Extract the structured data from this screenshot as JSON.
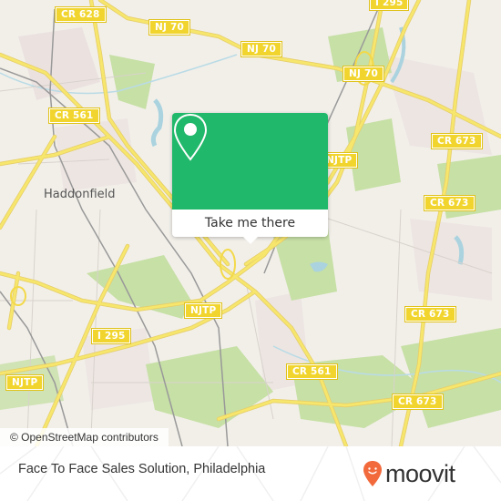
{
  "map": {
    "place_labels": [
      "Haddonfield"
    ],
    "road_shields": [
      "CR 628",
      "NJ 70",
      "NJ 70",
      "NJ 70",
      "I 295",
      "CR 561",
      "NJTP",
      "CR 673",
      "CR 673",
      "I 295",
      "NJTP",
      "NJTP",
      "CR 673",
      "CR 561",
      "CR 673"
    ],
    "attribution": "© OpenStreetMap contributors"
  },
  "popup": {
    "icon": "map-pin-icon",
    "action_label": "Take me there",
    "accent_color": "#20b86a"
  },
  "footer": {
    "title": "Face To Face Sales Solution, Philadelphia",
    "brand": "moovit",
    "brand_color": "#f26a3c"
  }
}
